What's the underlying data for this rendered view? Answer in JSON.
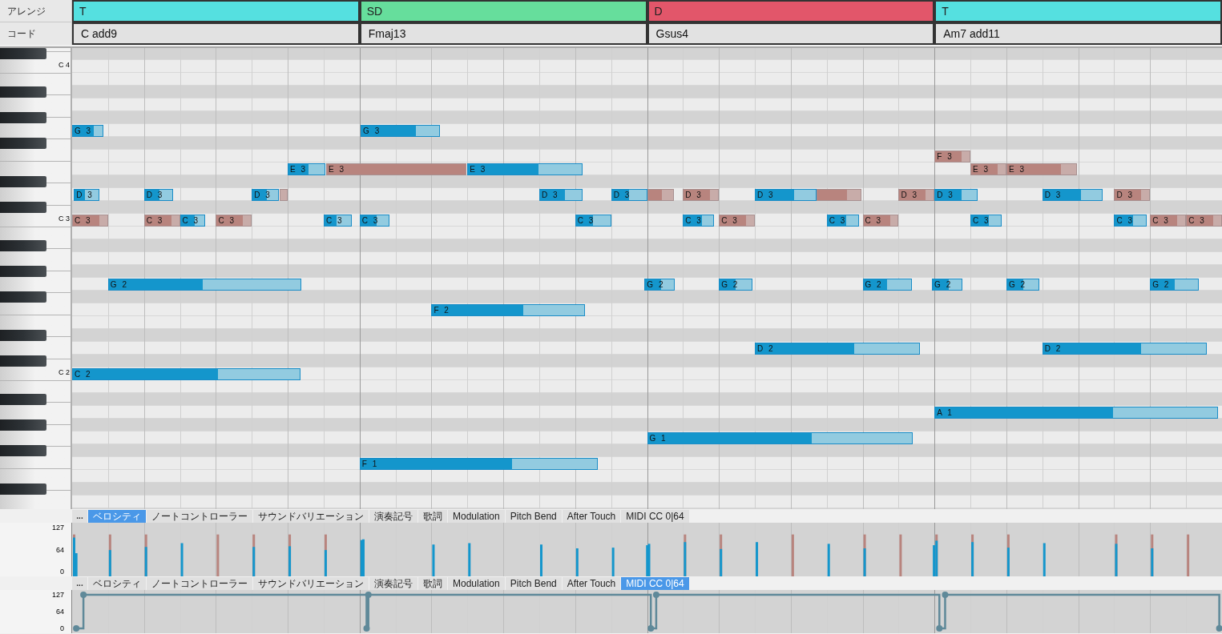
{
  "header": {
    "arrange_label": "アレンジ",
    "chord_label": "コード"
  },
  "arrange": [
    {
      "label": "T",
      "color": "#55e0e0"
    },
    {
      "label": "SD",
      "color": "#66de9c"
    },
    {
      "label": "D",
      "color": "#e2566a"
    },
    {
      "label": "T",
      "color": "#55e0e0"
    }
  ],
  "chords": [
    "C add9",
    "Fmaj13",
    "Gsus4",
    "Am7 add11"
  ],
  "piano_labels": [
    "C 4",
    "C 3",
    "C 2"
  ],
  "notes": [
    {
      "label": "G 3",
      "kind": "active",
      "level": 0.7
    },
    {
      "label": "G 3",
      "kind": "active",
      "level": 0.7
    },
    {
      "label": "F 3",
      "kind": "ghost",
      "level": 0.77
    },
    {
      "label": "E 3",
      "kind": "active",
      "level": 0.55
    },
    {
      "label": "E 3",
      "kind": "ghost",
      "level": 1
    },
    {
      "label": "E 3",
      "kind": "active",
      "level": 0.62
    },
    {
      "label": "E 3",
      "kind": "ghost",
      "level": 0.77
    },
    {
      "label": "E 3",
      "kind": "ghost",
      "level": 0.78
    },
    {
      "label": "D 3",
      "kind": "active",
      "level": 0.45
    },
    {
      "label": "D 3",
      "kind": "active",
      "level": 0.55
    },
    {
      "label": "D 3",
      "kind": "active",
      "level": 0.55
    },
    {
      "kind": "tail"
    },
    {
      "label": "D 3",
      "kind": "active",
      "level": 0.6
    },
    {
      "label": "D 3",
      "kind": "active",
      "level": 0.5
    },
    {
      "kind": "tail",
      "level": 0.55
    },
    {
      "label": "D 3",
      "kind": "ghost",
      "level": 0.77
    },
    {
      "label": "D 3",
      "kind": "active",
      "level": 0.64
    },
    {
      "kind": "tail",
      "level": 0.68
    },
    {
      "label": "D 3",
      "kind": "ghost",
      "level": 0.77
    },
    {
      "label": "D 3",
      "kind": "active",
      "level": 0.64
    },
    {
      "label": "D 3",
      "kind": "active",
      "level": 0.64
    },
    {
      "label": "D 3",
      "kind": "ghost",
      "level": 0.77
    },
    {
      "label": "C 3",
      "kind": "ghost",
      "level": 0.77
    },
    {
      "label": "C 3",
      "kind": "ghost",
      "level": 0.77
    },
    {
      "label": "C 3",
      "kind": "active",
      "level": 0.6
    },
    {
      "label": "C 3",
      "kind": "ghost",
      "level": 0.75
    },
    {
      "label": "C 3",
      "kind": "active",
      "level": 0.45
    },
    {
      "label": "C 3",
      "kind": "active",
      "level": 0.57
    },
    {
      "label": "C 3",
      "kind": "active",
      "level": 0.5
    },
    {
      "label": "C 3",
      "kind": "active",
      "level": 0.6
    },
    {
      "label": "C 3",
      "kind": "ghost",
      "level": 0.77
    },
    {
      "label": "C 3",
      "kind": "active",
      "level": 0.6
    },
    {
      "label": "C 3",
      "kind": "ghost",
      "level": 0.77
    },
    {
      "label": "C 3",
      "kind": "active",
      "level": 0.6
    },
    {
      "label": "C 3",
      "kind": "active",
      "level": 0.58
    },
    {
      "label": "C 3",
      "kind": "ghost",
      "level": 0.77
    },
    {
      "label": "C 3",
      "kind": "ghost",
      "level": 0.77
    },
    {
      "label": "G 2",
      "kind": "active",
      "level": 0.49
    },
    {
      "label": "G 2",
      "kind": "active",
      "level": 0.55
    },
    {
      "label": "G 2",
      "kind": "active",
      "level": 0.5
    },
    {
      "label": "G 2",
      "kind": "active",
      "level": 0.5
    },
    {
      "label": "G 2",
      "kind": "active",
      "level": 0.55
    },
    {
      "label": "G 2",
      "kind": "active",
      "level": 0.5
    },
    {
      "label": "G 2",
      "kind": "active",
      "level": 0.5
    },
    {
      "label": "F 2",
      "kind": "active",
      "level": 0.6
    },
    {
      "label": "D 2",
      "kind": "active",
      "level": 0.6
    },
    {
      "label": "D 2",
      "kind": "active",
      "level": 0.6
    },
    {
      "label": "C 2",
      "kind": "active",
      "level": 0.64
    },
    {
      "label": "A 1",
      "kind": "active",
      "level": 0.63
    },
    {
      "label": "G 1",
      "kind": "active",
      "level": 0.62
    },
    {
      "label": "F 1",
      "kind": "active",
      "level": 0.64
    }
  ],
  "lanes": [
    {
      "more": "...",
      "tabs": [
        {
          "label": "ベロシティ",
          "selected": true
        },
        {
          "label": "ノートコントローラー",
          "selected": false
        },
        {
          "label": "サウンドバリエーション",
          "selected": false
        },
        {
          "label": "演奏記号",
          "selected": false
        },
        {
          "label": "歌詞",
          "selected": false
        },
        {
          "label": "Modulation",
          "selected": false
        },
        {
          "label": "Pitch Bend",
          "selected": false
        },
        {
          "label": "After Touch",
          "selected": false
        },
        {
          "label": "MIDI CC 0|64",
          "selected": false
        }
      ],
      "kind": "velocity",
      "axis_labels": [
        "127",
        "64",
        "0"
      ]
    },
    {
      "more": "...",
      "tabs": [
        {
          "label": "ベロシティ",
          "selected": false
        },
        {
          "label": "ノートコントローラー",
          "selected": false
        },
        {
          "label": "サウンドバリエーション",
          "selected": false
        },
        {
          "label": "演奏記号",
          "selected": false
        },
        {
          "label": "歌詞",
          "selected": false
        },
        {
          "label": "Modulation",
          "selected": false
        },
        {
          "label": "Pitch Bend",
          "selected": false
        },
        {
          "label": "After Touch",
          "selected": false
        },
        {
          "label": "MIDI CC 0|64",
          "selected": true
        }
      ],
      "kind": "cc",
      "axis_labels": [
        "127",
        "64",
        "0"
      ]
    }
  ]
}
